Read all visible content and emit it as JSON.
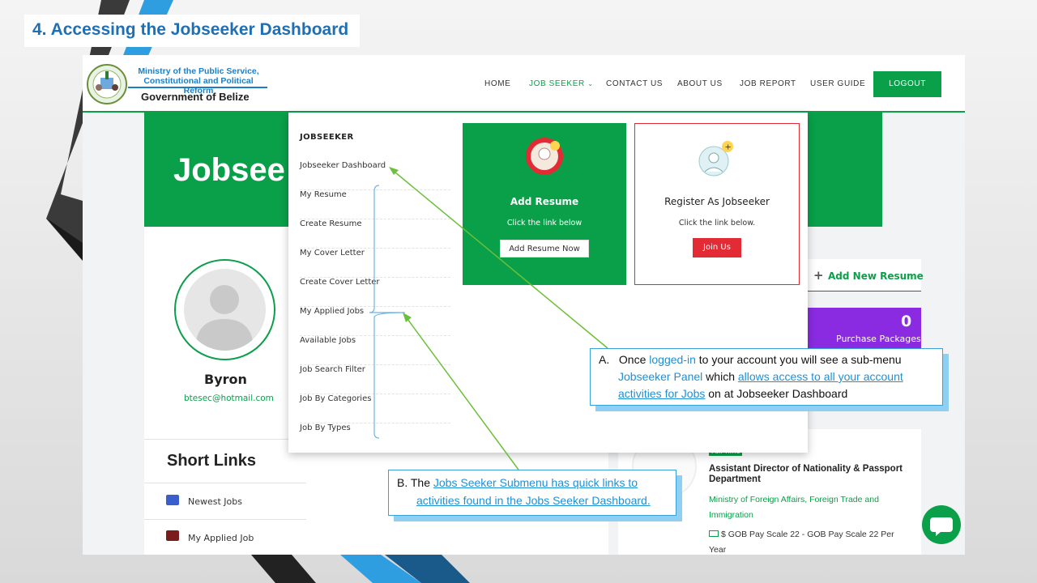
{
  "slide": {
    "title": "4.  Accessing the Jobseeker Dashboard"
  },
  "header": {
    "ministry_line1": "Ministry of the Public Service,",
    "ministry_line2": "Constitutional and Political Reform",
    "government": "Government of Belize",
    "nav": [
      {
        "label": "HOME"
      },
      {
        "label": "JOB SEEKER",
        "active": true,
        "chevron": "chevron-down-icon"
      },
      {
        "label": "CONTACT US"
      },
      {
        "label": "ABOUT US"
      },
      {
        "label": "JOB REPORT"
      },
      {
        "label": "USER GUIDE"
      }
    ],
    "logout": "LOGOUT"
  },
  "hero": {
    "title": "Jobsee"
  },
  "profile": {
    "name": "Byron",
    "email": "btesec@hotmail.com"
  },
  "short_links": {
    "title": "Short Links",
    "items": [
      {
        "label": "Newest Jobs",
        "icon": "briefcase-icon"
      },
      {
        "label": "My Applied Job",
        "icon": "suitcase-icon"
      }
    ]
  },
  "dropdown": {
    "heading": "JOBSEEKER",
    "items": [
      "Jobseeker Dashboard",
      "My Resume",
      "Create Resume",
      "My Cover Letter",
      "Create Cover Letter",
      "My Applied Jobs",
      "Available Jobs",
      "Job Search Filter",
      "Job By Categories",
      "Job By Types"
    ],
    "add_resume": {
      "title": "Add Resume",
      "subtitle": "Click the link below",
      "button": "Add Resume Now"
    },
    "register": {
      "title": "Register As Jobseeker",
      "subtitle": "Click the link below.",
      "button": "Join Us"
    }
  },
  "right_panel": {
    "add_new_resume": "Add New Resume",
    "purchase_count": "0",
    "purchase_label": "Purchase Packages",
    "job": {
      "badge": "Full-Time",
      "title": "Assistant Director of Nationality & Passport Department",
      "company": "Ministry of Foreign Affairs, Foreign Trade and Immigration",
      "pay": "$ GOB Pay Scale 22 - GOB Pay Scale 22 Per Year"
    }
  },
  "callout_a": {
    "prefix": "A.",
    "t1": "Once ",
    "t2": "logged-in",
    "t3": " to your account you will see a sub-menu",
    "t4": "Jobseeker Panel",
    "t5": " which ",
    "t6": "allows access to all your account",
    "t7": "activities for Jobs",
    "t8": " on at Jobseeker  Dashboard"
  },
  "callout_b": {
    "prefix": "B. The ",
    "t1": "Jobs Seeker Submenu  has quick links to",
    "t2": "activities found in the Jobs Seeker Dashboard."
  },
  "colors": {
    "brand_green": "#0aa04a",
    "accent_blue": "#1e90d6",
    "purple": "#8a2be2",
    "red": "#e22b34"
  }
}
